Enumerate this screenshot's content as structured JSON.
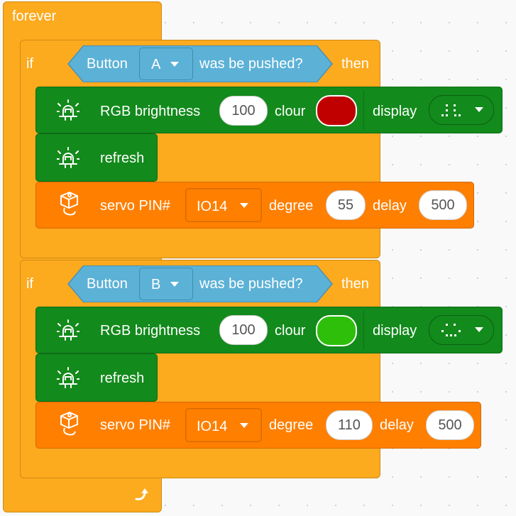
{
  "forever": {
    "label": "forever"
  },
  "colors": {
    "control": "#fcaa1e",
    "sensing": "#5cb1d6",
    "led": "#138a1c",
    "servo": "#ff7f00",
    "swatch_red": "#c00000",
    "swatch_green": "#2ebf0a"
  },
  "if_blocks": [
    {
      "if_label": "if",
      "then_label": "then",
      "condition": {
        "prefix": "Button",
        "button": "A",
        "suffix": "was be pushed?"
      },
      "rgb": {
        "icon": "led-light-icon",
        "label": "RGB brightness",
        "brightness": "100",
        "colour_label": "clour",
        "colour": "red",
        "display_label": "display",
        "display_icon": "smiley-pattern-icon"
      },
      "refresh": {
        "icon": "led-light-icon",
        "label": "refresh"
      },
      "servo": {
        "icon": "servo-icon",
        "label": "servo PIN#",
        "pin": "IO14",
        "degree_label": "degree",
        "degree": "55",
        "delay_label": "delay",
        "delay": "500"
      }
    },
    {
      "if_label": "if",
      "then_label": "then",
      "condition": {
        "prefix": "Button",
        "button": "B",
        "suffix": "was be pushed?"
      },
      "rgb": {
        "icon": "led-light-icon",
        "label": "RGB brightness",
        "brightness": "100",
        "colour_label": "clour",
        "colour": "green",
        "display_label": "display",
        "display_icon": "sad-pattern-icon"
      },
      "refresh": {
        "icon": "led-light-icon",
        "label": "refresh"
      },
      "servo": {
        "icon": "servo-icon",
        "label": "servo PIN#",
        "pin": "IO14",
        "degree_label": "degree",
        "degree": "110",
        "delay_label": "delay",
        "delay": "500"
      }
    }
  ],
  "loop_icon": "loop-arrow-icon"
}
